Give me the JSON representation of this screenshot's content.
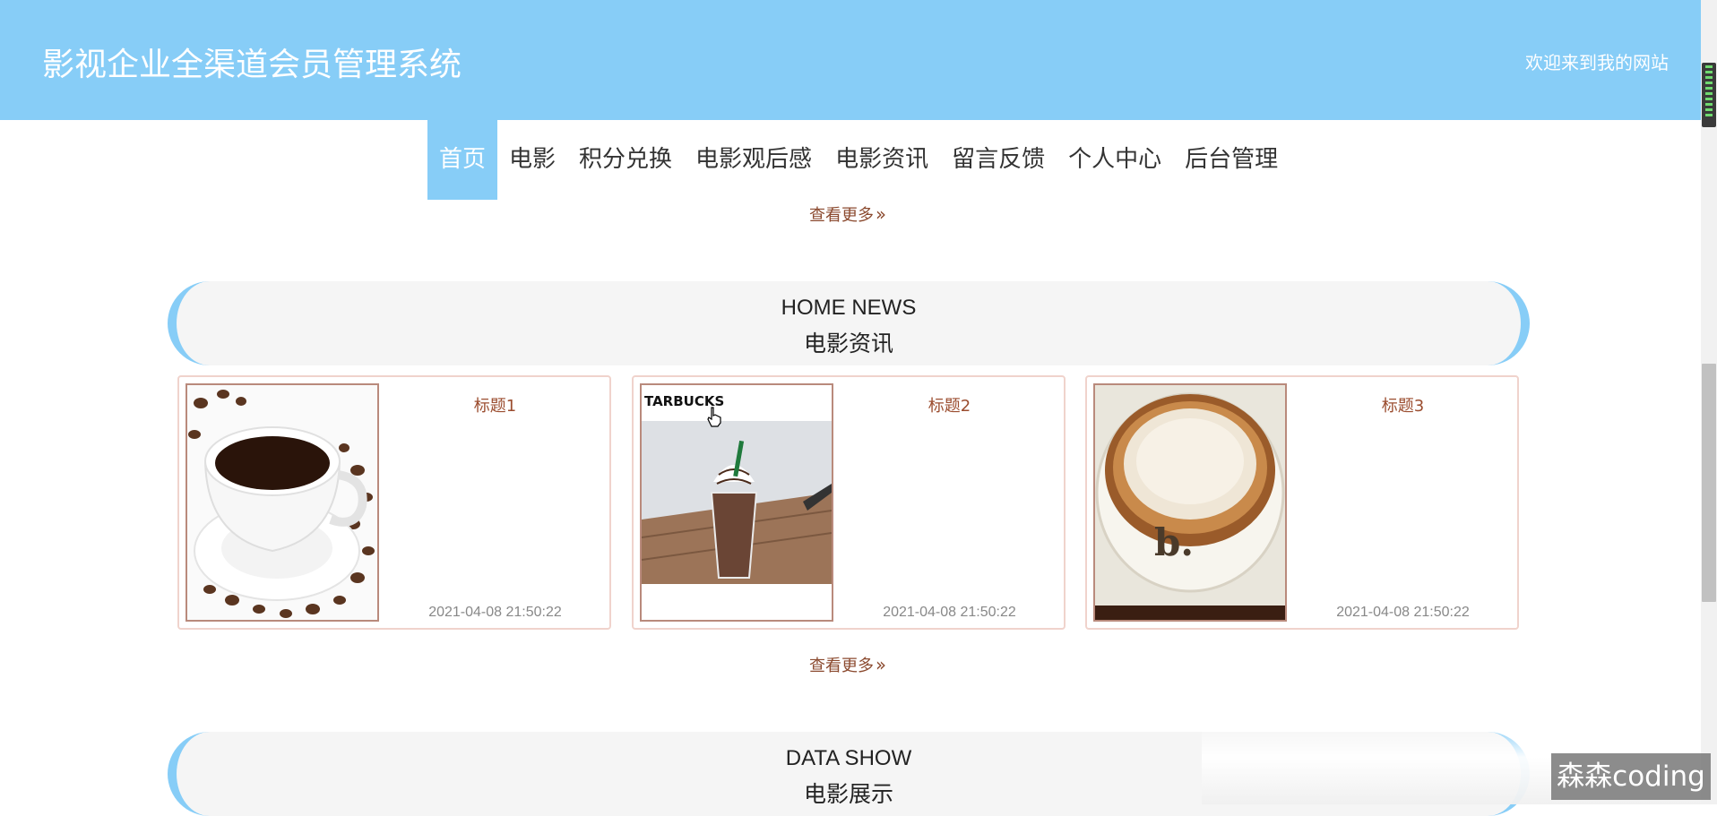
{
  "header": {
    "site_title": "影视企业全渠道会员管理系统",
    "welcome_text": "欢迎来到我的网站"
  },
  "nav": {
    "items": [
      "首页",
      "电影",
      "积分兑换",
      "电影观后感",
      "电影资讯",
      "留言反馈",
      "个人中心",
      "后台管理"
    ],
    "active": "首页"
  },
  "more_label": "查看更多",
  "news_section": {
    "title_en": "HOME NEWS",
    "title_zh": "电影资讯",
    "cards": [
      {
        "title": "标题1",
        "date": "2021-04-08 21:50:22",
        "image": "coffee-cup-with-beans"
      },
      {
        "title": "标题2",
        "date": "2021-04-08 21:50:22",
        "image": "starbucks-frappuccino",
        "image_brand": "TARBUCKS"
      },
      {
        "title": "标题3",
        "date": "2021-04-08 21:50:22",
        "image": "latte-cup-top-view"
      }
    ]
  },
  "data_section": {
    "title_en": "DATA SHOW",
    "title_zh": "电影展示"
  },
  "watermark": "森森coding",
  "colors": {
    "header_bg": "#87cdf7",
    "link": "#8b4a2f",
    "card_border": "#f0d3cc"
  }
}
